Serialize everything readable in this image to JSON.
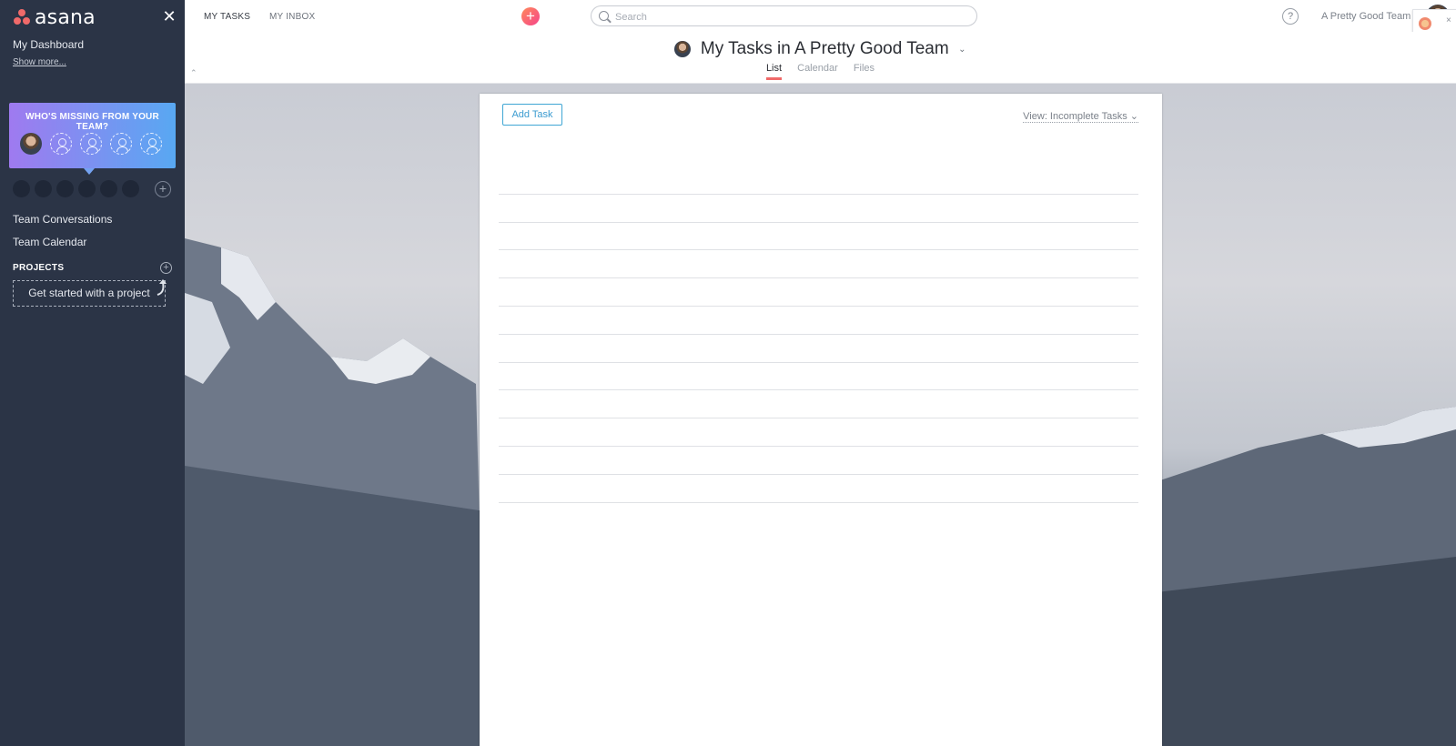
{
  "sidebar": {
    "logo_text": "asana",
    "nav": {
      "dashboard": "My Dashboard",
      "show_more": "Show more..."
    },
    "promo": {
      "title": "WHO'S MISSING FROM YOUR TEAM?"
    },
    "team_links": {
      "conversations": "Team Conversations",
      "calendar": "Team Calendar"
    },
    "projects": {
      "heading": "PROJECTS",
      "get_started": "Get started with a project"
    }
  },
  "topbar": {
    "my_tasks": "MY TASKS",
    "my_inbox": "MY INBOX",
    "search_placeholder": "Search",
    "help": "?",
    "team_name": "A Pretty Good Team",
    "notif_close": "×"
  },
  "page": {
    "title": "My Tasks in A Pretty Good Team",
    "subtabs": [
      "List",
      "Calendar",
      "Files"
    ],
    "active_subtab": "List"
  },
  "panel": {
    "add_task": "Add Task",
    "view_filter": "View: Incomplete Tasks",
    "empty_rows": 12
  },
  "colors": {
    "sidebar_bg": "#2b3446",
    "accent": "#f06a6a",
    "add_task_blue": "#3fa6d4",
    "promo_gradient": [
      "#9f7af0",
      "#58a8f2"
    ]
  },
  "icons": [
    "asana-logo-icon",
    "close-icon",
    "plus-icon",
    "search-icon",
    "help-icon",
    "collapse-icon",
    "chevron-down-icon",
    "user-placeholder-icon",
    "arrow-up-icon"
  ]
}
